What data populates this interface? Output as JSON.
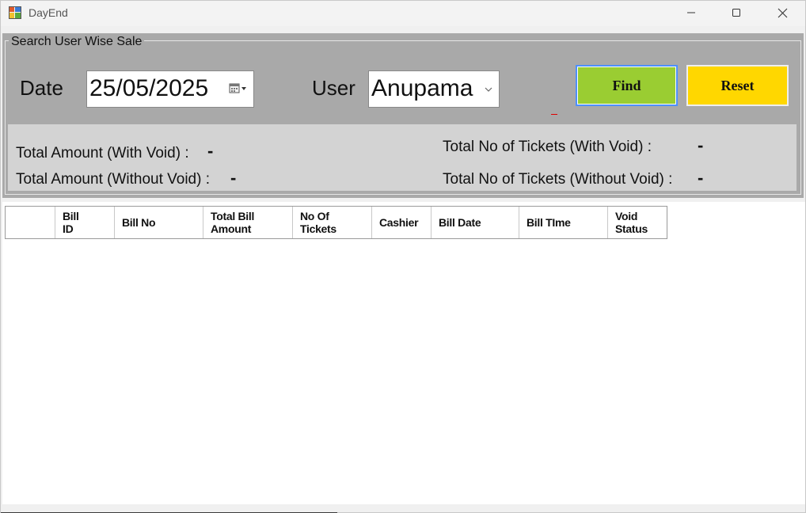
{
  "window": {
    "title": "DayEnd",
    "icons": {
      "app": "app-icon",
      "minimize": "minimize-icon",
      "maximize": "maximize-icon",
      "close": "close-icon"
    }
  },
  "search": {
    "group_title": "Search User Wise Sale",
    "date_label": "Date",
    "date_value": "25/05/2025",
    "user_label": "User",
    "user_value": "Anupama",
    "find_label": "Find",
    "reset_label": "Reset"
  },
  "summary": {
    "total_amount_with_void_label": "Total Amount (With Void) :",
    "total_amount_with_void_value": "-",
    "total_amount_without_void_label": "Total Amount (Without Void) :",
    "total_amount_without_void_value": "-",
    "total_tickets_with_void_label": "Total No of Tickets (With Void) :",
    "total_tickets_with_void_value": "-",
    "total_tickets_without_void_label": "Total No of Tickets (Without Void) :",
    "total_tickets_without_void_value": "-"
  },
  "grid": {
    "columns": [
      {
        "l1": "Bill",
        "l2": "ID"
      },
      {
        "l1": "Bill No",
        "l2": ""
      },
      {
        "l1": "Total Bill",
        "l2": "Amount"
      },
      {
        "l1": "No Of",
        "l2": "Tickets"
      },
      {
        "l1": "Cashier",
        "l2": ""
      },
      {
        "l1": "Bill Date",
        "l2": ""
      },
      {
        "l1": "Bill TIme",
        "l2": ""
      },
      {
        "l1": "Void",
        "l2": "Status"
      }
    ],
    "rows": []
  },
  "colors": {
    "find_button": "#9acd32",
    "reset_button": "#ffd700",
    "group_background": "#a9a9a9",
    "summary_background": "#d3d3d3"
  }
}
